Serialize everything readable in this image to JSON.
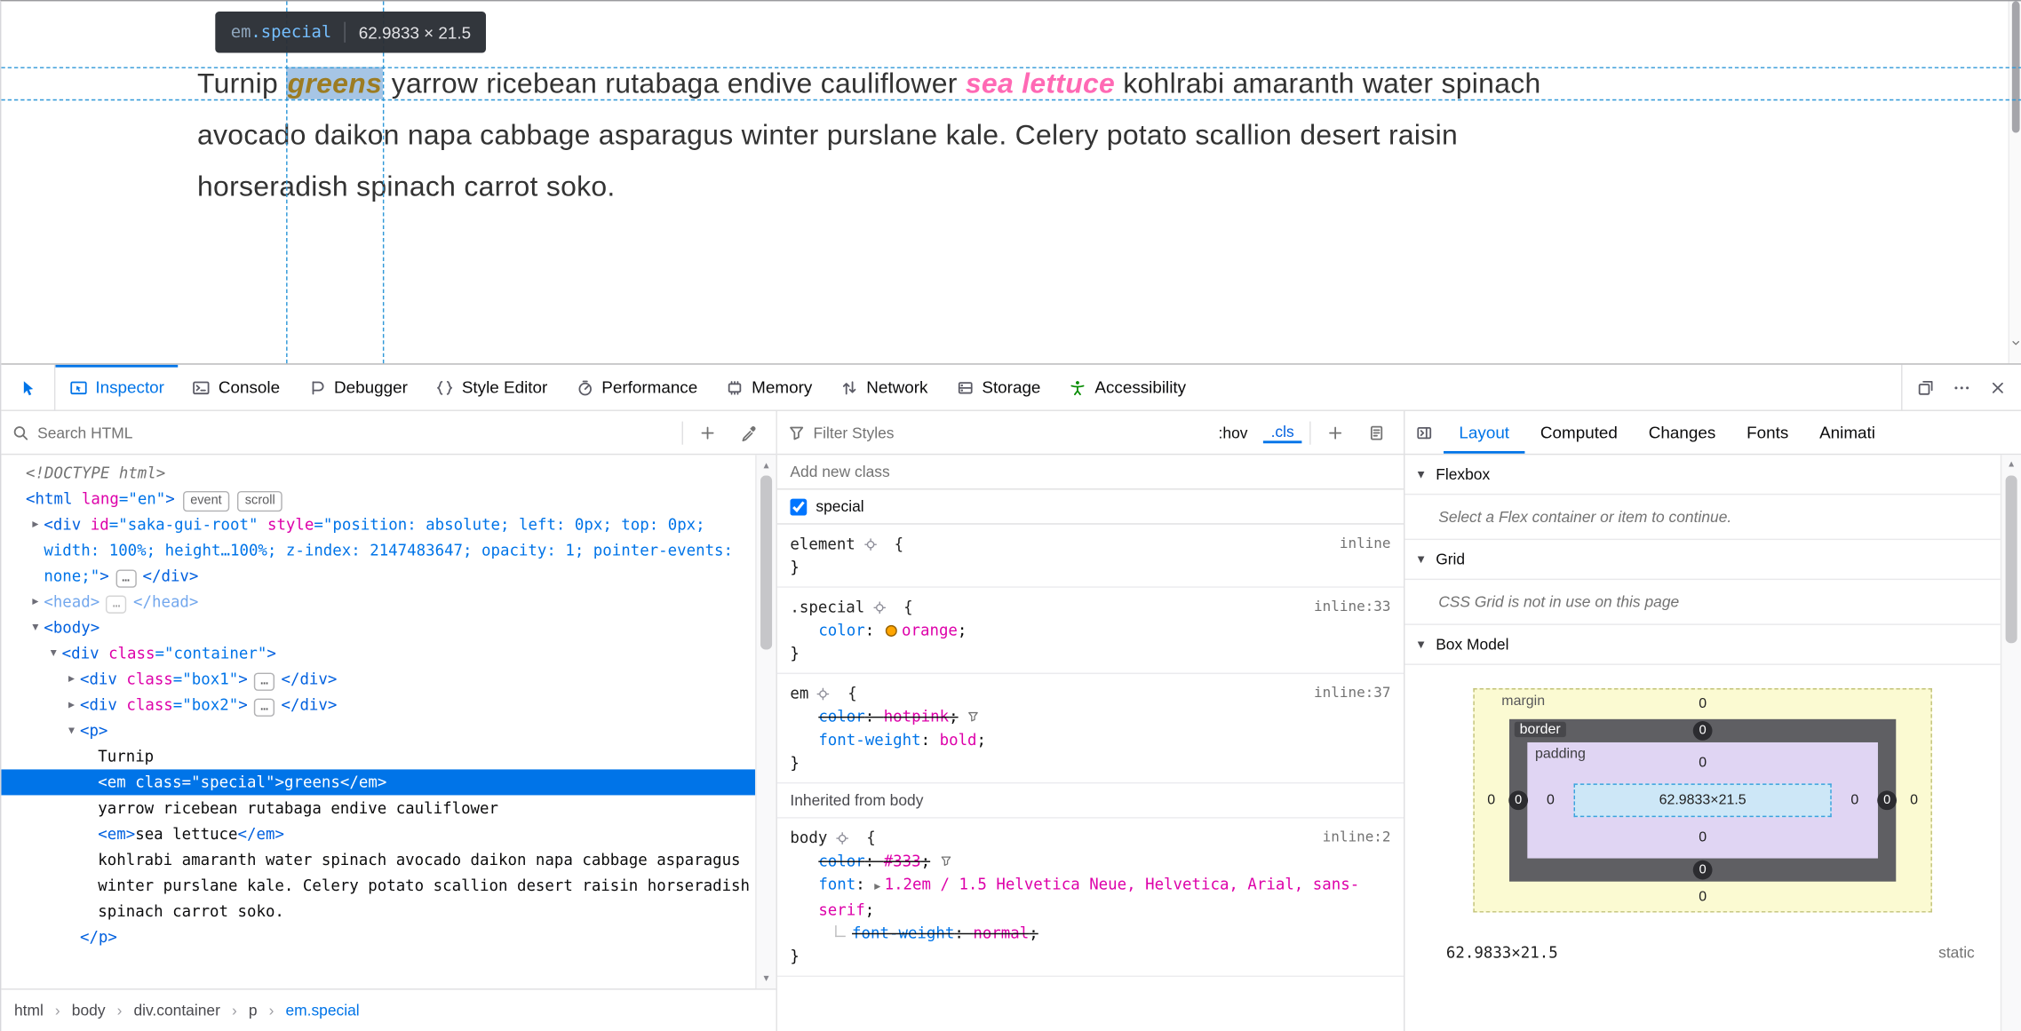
{
  "colors": {
    "accent": "#0074e8",
    "selection": "#0074e8",
    "guide": "#2f98d8",
    "orange_swatch": "#ffa500",
    "accessibility_green": "#058b00"
  },
  "page": {
    "tooltip": {
      "tag": "em",
      "cls": ".special",
      "dims": "62.9833 × 21.5"
    },
    "line1": {
      "t1": "Turnip ",
      "em_special": "greens",
      "t2": " yarrow ricebean rutabaga endive cauliflower ",
      "em_plain": "sea lettuce",
      "t3": " kohlrabi amaranth water spinach"
    },
    "line2": "avocado daikon napa cabbage asparagus winter purslane kale. Celery potato scallion desert raisin",
    "line3": "horseradish spinach carrot soko."
  },
  "toolbar": {
    "tabs": [
      {
        "id": "inspector",
        "label": "Inspector",
        "icon": "inspector-icon",
        "active": true
      },
      {
        "id": "console",
        "label": "Console",
        "icon": "console-icon"
      },
      {
        "id": "debugger",
        "label": "Debugger",
        "icon": "debugger-icon"
      },
      {
        "id": "style-editor",
        "label": "Style Editor",
        "icon": "style-editor-icon"
      },
      {
        "id": "performance",
        "label": "Performance",
        "icon": "performance-icon"
      },
      {
        "id": "memory",
        "label": "Memory",
        "icon": "memory-icon"
      },
      {
        "id": "network",
        "label": "Network",
        "icon": "network-icon"
      },
      {
        "id": "storage",
        "label": "Storage",
        "icon": "storage-icon"
      },
      {
        "id": "accessibility",
        "label": "Accessibility",
        "icon": "accessibility-icon",
        "icon_color": "#058b00"
      }
    ]
  },
  "markup": {
    "search_placeholder": "Search HTML",
    "lines": [
      {
        "l": 0,
        "t": "",
        "name": "node-doctype",
        "k": [
          [
            "doctype",
            "<!DOCTYPE html>"
          ]
        ]
      },
      {
        "l": 0,
        "t": "",
        "name": "node-html",
        "k": [
          [
            "tag",
            "<html"
          ],
          [
            "attr",
            " lang"
          ],
          [
            "pun",
            "=\""
          ],
          [
            "val",
            "en"
          ],
          [
            "pun",
            "\""
          ],
          [
            "tag",
            ">"
          ],
          [
            "badge",
            "event"
          ],
          [
            "badge",
            "scroll"
          ]
        ]
      },
      {
        "l": 1,
        "t": "closed",
        "name": "node-div-saka-gui-root",
        "k": [
          [
            "tag",
            "<div"
          ],
          [
            "attr",
            " id"
          ],
          [
            "pun",
            "=\""
          ],
          [
            "val",
            "saka-gui-root"
          ],
          [
            "pun",
            "\""
          ],
          [
            "attr",
            " style"
          ],
          [
            "pun",
            "=\""
          ],
          [
            "val",
            "position: absolute; left: 0px; top: 0px; width: 100%; height…100%; z-index: 2147483647; opacity: 1; pointer-events: none;"
          ],
          [
            "pun",
            "\""
          ],
          [
            "tag",
            ">"
          ],
          [
            "dots",
            "…"
          ],
          [
            "tag",
            "</div>"
          ]
        ]
      },
      {
        "l": 1,
        "t": "closed",
        "dim": true,
        "name": "node-head",
        "k": [
          [
            "tag",
            "<head>"
          ],
          [
            "dots",
            "…"
          ],
          [
            "tag",
            "</head>"
          ]
        ]
      },
      {
        "l": 1,
        "t": "open",
        "name": "node-body",
        "k": [
          [
            "tag",
            "<body>"
          ]
        ]
      },
      {
        "l": 2,
        "t": "open",
        "name": "node-div-container",
        "k": [
          [
            "tag",
            "<div"
          ],
          [
            "attr",
            " class"
          ],
          [
            "pun",
            "=\""
          ],
          [
            "val",
            "container"
          ],
          [
            "pun",
            "\""
          ],
          [
            "tag",
            ">"
          ]
        ]
      },
      {
        "l": 3,
        "t": "closed",
        "name": "node-div-box1",
        "k": [
          [
            "tag",
            "<div"
          ],
          [
            "attr",
            " class"
          ],
          [
            "pun",
            "=\""
          ],
          [
            "val",
            "box1"
          ],
          [
            "pun",
            "\""
          ],
          [
            "tag",
            ">"
          ],
          [
            "dots",
            "…"
          ],
          [
            "tag",
            "</div>"
          ]
        ]
      },
      {
        "l": 3,
        "t": "closed",
        "name": "node-div-box2",
        "k": [
          [
            "tag",
            "<div"
          ],
          [
            "attr",
            " class"
          ],
          [
            "pun",
            "=\""
          ],
          [
            "val",
            "box2"
          ],
          [
            "pun",
            "\""
          ],
          [
            "tag",
            ">"
          ],
          [
            "dots",
            "…"
          ],
          [
            "tag",
            "</div>"
          ]
        ]
      },
      {
        "l": 3,
        "t": "open",
        "name": "node-p",
        "k": [
          [
            "tag",
            "<p>"
          ]
        ]
      },
      {
        "l": 4,
        "t": "",
        "name": "node-text-turnip",
        "k": [
          [
            "txt",
            "Turnip"
          ]
        ]
      },
      {
        "l": 4,
        "t": "",
        "sel": true,
        "name": "node-em-special",
        "k": [
          [
            "tag",
            "<em"
          ],
          [
            "attr",
            " class"
          ],
          [
            "pun",
            "=\""
          ],
          [
            "val",
            "special"
          ],
          [
            "pun",
            "\""
          ],
          [
            "tag",
            ">"
          ],
          [
            "txt",
            "greens"
          ],
          [
            "tag",
            "</em>"
          ]
        ]
      },
      {
        "l": 4,
        "t": "",
        "name": "node-text-yarrow",
        "k": [
          [
            "txt",
            "yarrow ricebean rutabaga endive cauliflower"
          ]
        ]
      },
      {
        "l": 4,
        "t": "",
        "name": "node-em-sea-lettuce",
        "k": [
          [
            "tag",
            "<em>"
          ],
          [
            "txt",
            "sea lettuce"
          ],
          [
            "tag",
            "</em>"
          ]
        ]
      },
      {
        "l": 4,
        "t": "",
        "name": "node-text-kohlrabi",
        "k": [
          [
            "txt",
            "kohlrabi amaranth water spinach avocado daikon napa cabbage asparagus winter purslane kale. Celery potato scallion desert raisin horseradish spinach carrot soko."
          ]
        ]
      },
      {
        "l": 3,
        "t": "",
        "name": "node-p-close",
        "k": [
          [
            "tag",
            "</p>"
          ]
        ]
      }
    ],
    "breadcrumbs": [
      {
        "label": "html"
      },
      {
        "label": "body"
      },
      {
        "label": "div.container"
      },
      {
        "label": "p"
      },
      {
        "label": "em.special",
        "active": true
      }
    ]
  },
  "rules": {
    "filter_placeholder": "Filter Styles",
    "hov_label": ":hov",
    "cls_label": ".cls",
    "add_class_placeholder": "Add new class",
    "class_toggles": [
      {
        "label": "special",
        "checked": true
      }
    ],
    "blocks": [
      {
        "type": "rule",
        "selector": "element",
        "loc": "inline",
        "decls": []
      },
      {
        "type": "rule",
        "selector": ".special",
        "loc": "inline:33",
        "decls": [
          {
            "name": "color",
            "value": "orange",
            "swatch": "#ffa500"
          }
        ]
      },
      {
        "type": "rule",
        "selector": "em",
        "loc": "inline:37",
        "decls": [
          {
            "name": "color",
            "value": "hotpink",
            "struck": true,
            "funnel": true
          },
          {
            "name": "font-weight",
            "value": "bold"
          }
        ]
      },
      {
        "type": "header",
        "label": "Inherited from body"
      },
      {
        "type": "rule",
        "selector": "body",
        "loc": "inline:2",
        "decls": [
          {
            "name": "color",
            "value": "#333",
            "struck": true,
            "funnel": true
          },
          {
            "name": "font",
            "value": "1.2em / 1.5 Helvetica Neue, Helvetica, Arial, sans-serif",
            "twisty": true
          },
          {
            "name": "font-weight",
            "value": "normal",
            "struck": true,
            "sub": true
          }
        ]
      }
    ]
  },
  "sidebar": {
    "tabs": [
      {
        "id": "layout",
        "label": "Layout",
        "active": true
      },
      {
        "id": "computed",
        "label": "Computed"
      },
      {
        "id": "changes",
        "label": "Changes"
      },
      {
        "id": "fonts",
        "label": "Fonts"
      },
      {
        "id": "animations",
        "label": "Animati"
      }
    ],
    "flexbox": {
      "title": "Flexbox",
      "message": "Select a Flex container or item to continue."
    },
    "grid": {
      "title": "Grid",
      "message": "CSS Grid is not in use on this page"
    },
    "box_model": {
      "title": "Box Model",
      "margin_label": "margin",
      "border_label": "border",
      "padding_label": "padding",
      "content": "62.9833×21.5",
      "margin": {
        "top": "0",
        "right": "0",
        "bottom": "0",
        "left": "0"
      },
      "border": {
        "top": "0",
        "right": "0",
        "bottom": "0",
        "left": "0"
      },
      "padding": {
        "top": "0",
        "right": "0",
        "bottom": "0",
        "left": "0"
      },
      "footer_size": "62.9833×21.5",
      "footer_position": "static"
    }
  }
}
